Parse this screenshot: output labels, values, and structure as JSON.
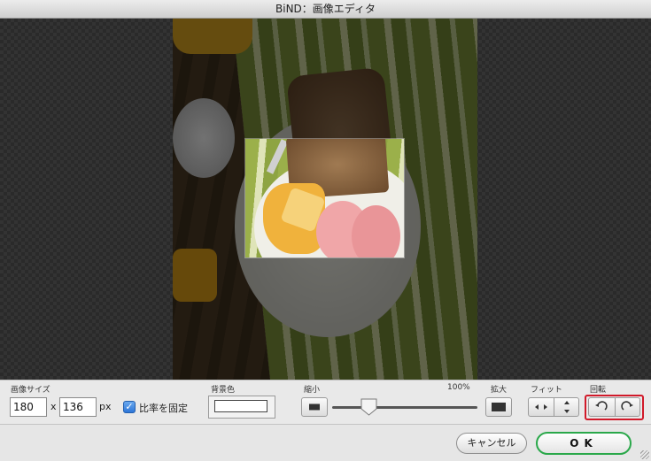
{
  "window": {
    "title": "BiND：画像エディタ"
  },
  "image_size": {
    "label": "画像サイズ",
    "width": "180",
    "separator": "x",
    "height": "136",
    "unit": "px"
  },
  "aspect_lock": {
    "label": "比率を固定",
    "checked": true
  },
  "background_color": {
    "label": "背景色",
    "value": "#ffffff"
  },
  "zoom": {
    "label_shrink": "縮小",
    "percent_label": "100%",
    "label_enlarge": "拡大",
    "slider_value": 0.25
  },
  "fit": {
    "label": "フィット",
    "horizontal_icon": "fit-horizontal-icon",
    "vertical_icon": "fit-vertical-icon"
  },
  "rotate": {
    "label": "回転",
    "ccw_icon": "rotate-left-icon",
    "cw_icon": "rotate-right-icon",
    "highlight_color": "#d11a2a"
  },
  "footer": {
    "cancel_label": "キャンセル",
    "ok_label": "OK"
  },
  "colors": {
    "ok_border": "#2aa84a",
    "checkbox": "#2d76d8"
  }
}
